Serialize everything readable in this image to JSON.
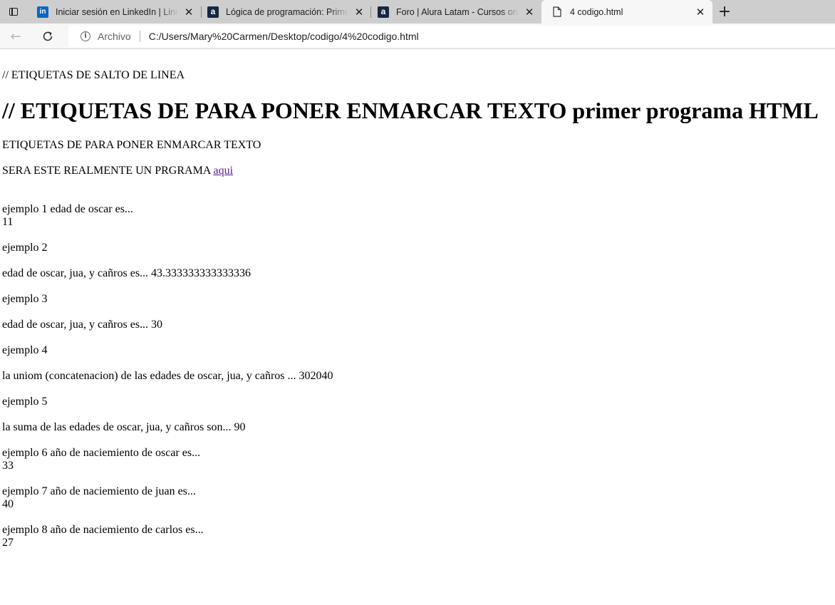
{
  "browser": {
    "tabs": [
      {
        "title": "Iniciar sesión en LinkedIn | LinkedIn",
        "icon": "linkedin-icon"
      },
      {
        "title": "Lógica de programación: Primeros pasos",
        "icon": "alura-icon"
      },
      {
        "title": "Foro | Alura Latam - Cursos online",
        "icon": "alura-icon"
      },
      {
        "title": "4 codigo.html",
        "icon": "file-icon"
      }
    ],
    "address_label": "Archivo",
    "url": "C:/Users/Mary%20Carmen/Desktop/codigo/4%20codigo.html"
  },
  "page": {
    "line1": "// ETIQUETAS DE SALTO DE LINEA",
    "heading": "// ETIQUETAS DE PARA PONER ENMARCAR TEXTO primer programa HTML",
    "para1": "ETIQUETAS DE PARA PONER ENMARCAR TEXTO",
    "para2_text": "SERA ESTE REALMENTE UN PRGRAMA ",
    "para2_link": "aqui",
    "ex1_label": "ejemplo 1 edad de oscar es...",
    "ex1_value": "11",
    "ex2_label": "ejemplo 2",
    "ex2_text": "edad de oscar, jua, y cañros es... 43.333333333333336",
    "ex3_label": "ejemplo 3",
    "ex3_text": "edad de oscar, jua, y cañros es... 30",
    "ex4_label": "ejemplo 4",
    "ex4_text": "la uniom (concatenacion) de las edades de oscar, jua, y cañros ... 302040",
    "ex5_label": "ejemplo 5",
    "ex5_text": "la suma de las edades de oscar, jua, y cañros son... 90",
    "ex6_label": "ejemplo 6 año de naciemiento de oscar es...",
    "ex6_value": "33",
    "ex7_label": "ejemplo 7 año de naciemiento de juan es...",
    "ex7_value": "40",
    "ex8_label": "ejemplo 8 año de naciemiento de carlos es...",
    "ex8_value": "27"
  }
}
